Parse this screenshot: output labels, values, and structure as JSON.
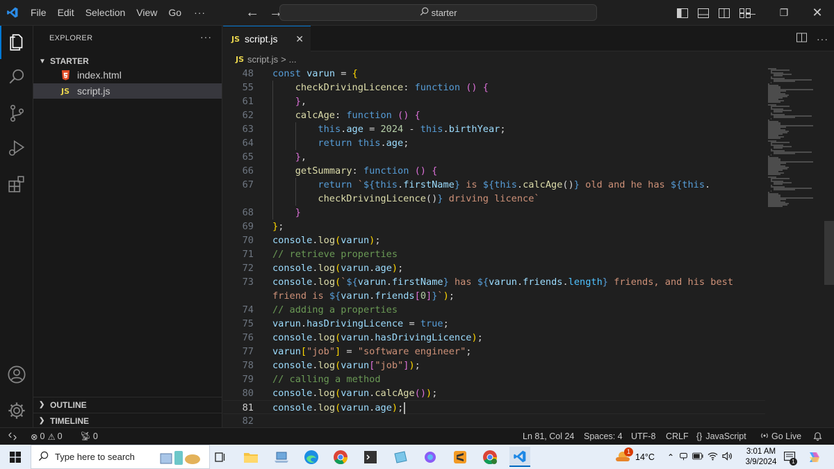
{
  "titlebar": {
    "menus": [
      "File",
      "Edit",
      "Selection",
      "View",
      "Go"
    ],
    "more": "···",
    "search_text": "starter",
    "search_icon": "search-icon"
  },
  "sidebar": {
    "title": "EXPLORER",
    "more": "···",
    "folder": "STARTER",
    "files": [
      {
        "name": "index.html",
        "icon": "html5-icon"
      },
      {
        "name": "script.js",
        "icon": "js-icon",
        "selected": true
      }
    ],
    "sections": [
      "OUTLINE",
      "TIMELINE"
    ]
  },
  "editor": {
    "tab_label": "script.js",
    "tab_icon_text": "JS",
    "breadcrumb": "script.js",
    "breadcrumb_sep": ">",
    "breadcrumb_more": "...",
    "lines": [
      {
        "n": "48",
        "indent": 0,
        "tokens": [
          [
            "kw",
            "const "
          ],
          [
            "var",
            "varun "
          ],
          [
            "punc",
            "= "
          ],
          [
            "brk1",
            "{"
          ]
        ]
      },
      {
        "n": "55",
        "indent": 1,
        "tokens": [
          [
            "fn",
            "checkDrivingLicence"
          ],
          [
            "punc",
            ": "
          ],
          [
            "kw",
            "function "
          ],
          [
            "brk2",
            "() "
          ],
          [
            "brk2",
            "{"
          ]
        ]
      },
      {
        "n": "61",
        "indent": 1,
        "tokens": [
          [
            "brk2",
            "}"
          ],
          [
            "punc",
            ","
          ]
        ]
      },
      {
        "n": "62",
        "indent": 1,
        "tokens": [
          [
            "fn",
            "calcAge"
          ],
          [
            "punc",
            ": "
          ],
          [
            "kw",
            "function "
          ],
          [
            "brk2",
            "() "
          ],
          [
            "brk2",
            "{"
          ]
        ]
      },
      {
        "n": "63",
        "indent": 2,
        "tokens": [
          [
            "kw",
            "this"
          ],
          [
            "punc",
            "."
          ],
          [
            "prop",
            "age "
          ],
          [
            "punc",
            "= "
          ],
          [
            "num",
            "2024 "
          ],
          [
            "punc",
            "- "
          ],
          [
            "kw",
            "this"
          ],
          [
            "punc",
            "."
          ],
          [
            "prop",
            "birthYear"
          ],
          [
            "punc",
            ";"
          ]
        ]
      },
      {
        "n": "64",
        "indent": 2,
        "tokens": [
          [
            "kw",
            "return "
          ],
          [
            "kw",
            "this"
          ],
          [
            "punc",
            "."
          ],
          [
            "prop",
            "age"
          ],
          [
            "punc",
            ";"
          ]
        ]
      },
      {
        "n": "65",
        "indent": 1,
        "tokens": [
          [
            "brk2",
            "}"
          ],
          [
            "punc",
            ","
          ]
        ]
      },
      {
        "n": "66",
        "indent": 1,
        "tokens": [
          [
            "fn",
            "getSummary"
          ],
          [
            "punc",
            ": "
          ],
          [
            "kw",
            "function "
          ],
          [
            "brk2",
            "() "
          ],
          [
            "brk2",
            "{"
          ]
        ]
      },
      {
        "n": "67",
        "indent": 2,
        "tokens": [
          [
            "kw",
            "return "
          ],
          [
            "str",
            "`"
          ],
          [
            "kw",
            "${"
          ],
          [
            "kw",
            "this"
          ],
          [
            "punc",
            "."
          ],
          [
            "prop",
            "firstName"
          ],
          [
            "kw",
            "}"
          ],
          [
            "str",
            " is "
          ],
          [
            "kw",
            "${"
          ],
          [
            "kw",
            "this"
          ],
          [
            "punc",
            "."
          ],
          [
            "fn",
            "calcAge"
          ],
          [
            "punc",
            "()"
          ],
          [
            "kw",
            "}"
          ],
          [
            "str",
            " old and he has "
          ],
          [
            "kw",
            "${"
          ],
          [
            "kw",
            "this"
          ],
          [
            "punc",
            "."
          ]
        ]
      },
      {
        "n": "",
        "indent": 2,
        "tokens": [
          [
            "fn",
            "checkDrivingLicence"
          ],
          [
            "punc",
            "()"
          ],
          [
            "kw",
            "}"
          ],
          [
            "str",
            " driving licence`"
          ]
        ]
      },
      {
        "n": "68",
        "indent": 1,
        "tokens": [
          [
            "brk2",
            "}"
          ]
        ]
      },
      {
        "n": "69",
        "indent": 0,
        "tokens": [
          [
            "brk1",
            "}"
          ],
          [
            "punc",
            ";"
          ]
        ]
      },
      {
        "n": "70",
        "indent": 0,
        "tokens": [
          [
            "var",
            "console"
          ],
          [
            "punc",
            "."
          ],
          [
            "fn",
            "log"
          ],
          [
            "brk1",
            "("
          ],
          [
            "var",
            "varun"
          ],
          [
            "brk1",
            ")"
          ],
          [
            "punc",
            ";"
          ]
        ]
      },
      {
        "n": "71",
        "indent": 0,
        "tokens": [
          [
            "com",
            "// retrieve properties"
          ]
        ]
      },
      {
        "n": "72",
        "indent": 0,
        "tokens": [
          [
            "var",
            "console"
          ],
          [
            "punc",
            "."
          ],
          [
            "fn",
            "log"
          ],
          [
            "brk1",
            "("
          ],
          [
            "var",
            "varun"
          ],
          [
            "punc",
            "."
          ],
          [
            "prop",
            "age"
          ],
          [
            "brk1",
            ")"
          ],
          [
            "punc",
            ";"
          ]
        ]
      },
      {
        "n": "73",
        "indent": 0,
        "tokens": [
          [
            "var",
            "console"
          ],
          [
            "punc",
            "."
          ],
          [
            "fn",
            "log"
          ],
          [
            "brk1",
            "("
          ],
          [
            "str",
            "`"
          ],
          [
            "kw",
            "${"
          ],
          [
            "var",
            "varun"
          ],
          [
            "punc",
            "."
          ],
          [
            "prop",
            "firstName"
          ],
          [
            "kw",
            "}"
          ],
          [
            "str",
            " has "
          ],
          [
            "kw",
            "${"
          ],
          [
            "var",
            "varun"
          ],
          [
            "punc",
            "."
          ],
          [
            "prop",
            "friends"
          ],
          [
            "punc",
            "."
          ],
          [
            "const",
            "length"
          ],
          [
            "kw",
            "}"
          ],
          [
            "str",
            " friends, and his best"
          ]
        ]
      },
      {
        "n": "",
        "indent": 0,
        "tokens": [
          [
            "str",
            "friend is "
          ],
          [
            "kw",
            "${"
          ],
          [
            "var",
            "varun"
          ],
          [
            "punc",
            "."
          ],
          [
            "prop",
            "friends"
          ],
          [
            "brk2",
            "["
          ],
          [
            "num",
            "0"
          ],
          [
            "brk2",
            "]"
          ],
          [
            "kw",
            "}"
          ],
          [
            "str",
            "`"
          ],
          [
            "brk1",
            ")"
          ],
          [
            "punc",
            ";"
          ]
        ]
      },
      {
        "n": "74",
        "indent": 0,
        "tokens": [
          [
            "com",
            "// adding a properties"
          ]
        ]
      },
      {
        "n": "75",
        "indent": 0,
        "tokens": [
          [
            "var",
            "varun"
          ],
          [
            "punc",
            "."
          ],
          [
            "prop",
            "hasDrivingLicence "
          ],
          [
            "punc",
            "= "
          ],
          [
            "kw",
            "true"
          ],
          [
            "punc",
            ";"
          ]
        ]
      },
      {
        "n": "76",
        "indent": 0,
        "tokens": [
          [
            "var",
            "console"
          ],
          [
            "punc",
            "."
          ],
          [
            "fn",
            "log"
          ],
          [
            "brk1",
            "("
          ],
          [
            "var",
            "varun"
          ],
          [
            "punc",
            "."
          ],
          [
            "prop",
            "hasDrivingLicence"
          ],
          [
            "brk1",
            ")"
          ],
          [
            "punc",
            ";"
          ]
        ]
      },
      {
        "n": "77",
        "indent": 0,
        "tokens": [
          [
            "var",
            "varun"
          ],
          [
            "brk1",
            "["
          ],
          [
            "str",
            "\"job\""
          ],
          [
            "brk1",
            "] "
          ],
          [
            "punc",
            "= "
          ],
          [
            "str",
            "\"software engineer\""
          ],
          [
            "punc",
            ";"
          ]
        ]
      },
      {
        "n": "78",
        "indent": 0,
        "tokens": [
          [
            "var",
            "console"
          ],
          [
            "punc",
            "."
          ],
          [
            "fn",
            "log"
          ],
          [
            "brk1",
            "("
          ],
          [
            "var",
            "varun"
          ],
          [
            "brk2",
            "["
          ],
          [
            "str",
            "\"job\""
          ],
          [
            "brk2",
            "]"
          ],
          [
            "brk1",
            ")"
          ],
          [
            "punc",
            ";"
          ]
        ]
      },
      {
        "n": "79",
        "indent": 0,
        "tokens": [
          [
            "com",
            "// calling a method"
          ]
        ]
      },
      {
        "n": "80",
        "indent": 0,
        "tokens": [
          [
            "var",
            "console"
          ],
          [
            "punc",
            "."
          ],
          [
            "fn",
            "log"
          ],
          [
            "brk1",
            "("
          ],
          [
            "var",
            "varun"
          ],
          [
            "punc",
            "."
          ],
          [
            "fn",
            "calcAge"
          ],
          [
            "brk2",
            "()"
          ],
          [
            "brk1",
            ")"
          ],
          [
            "punc",
            ";"
          ]
        ]
      },
      {
        "n": "81",
        "indent": 0,
        "current": true,
        "tokens": [
          [
            "var",
            "console"
          ],
          [
            "punc",
            "."
          ],
          [
            "fn",
            "log"
          ],
          [
            "brk1",
            "("
          ],
          [
            "var",
            "varun"
          ],
          [
            "punc",
            "."
          ],
          [
            "prop",
            "age"
          ],
          [
            "brk1",
            ")"
          ],
          [
            "punc",
            ";"
          ]
        ]
      },
      {
        "n": "82",
        "indent": 0,
        "tokens": []
      }
    ]
  },
  "statusbar": {
    "errors": "0",
    "warnings": "0",
    "ports": "0",
    "position": "Ln 81, Col 24",
    "spaces": "Spaces: 4",
    "encoding": "UTF-8",
    "eol": "CRLF",
    "language": "JavaScript",
    "language_icon": "{}",
    "golive": "Go Live"
  },
  "taskbar": {
    "search_placeholder": "Type here to search",
    "weather": "14°C",
    "weather_badge": "1",
    "time": "3:01 AM",
    "date": "3/9/2024",
    "notification_count": "1"
  },
  "colors": {
    "accent": "#0078d4",
    "editor_bg": "#1f1f1f",
    "sidebar_bg": "#181818",
    "keyword": "#569cd6",
    "function": "#dcdcaa",
    "string": "#ce9178",
    "comment": "#6a9955"
  }
}
